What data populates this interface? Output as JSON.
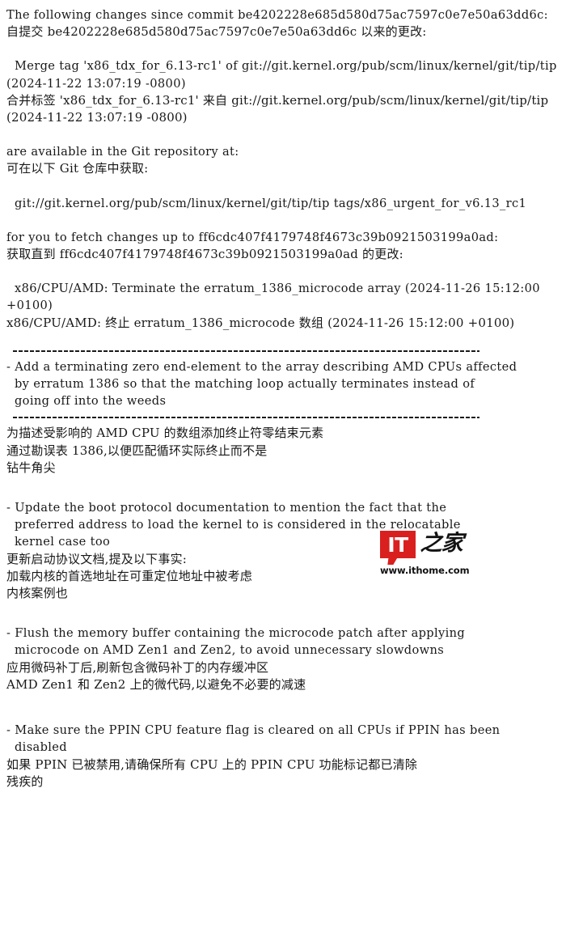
{
  "document": {
    "kind": "kernel-pull-request-bilingual",
    "source_commit": "be4202228e685d580d75ac7597c0e7e50a63dd6c",
    "head_commit": "ff6cdc407f4179748f4673c39b0921503199a0ad",
    "tag": "x86_urgent_for_v6.13_rc1",
    "repo_url": "git://git.kernel.org/pub/scm/linux/kernel/git/tip/tip"
  },
  "body": [
    {
      "id": "intro",
      "lines": [
        {
          "lang": "en",
          "text": "The following changes since commit be4202228e685d580d75ac7597c0e7e50a63dd6c:"
        },
        {
          "lang": "zh",
          "text": "自提交 be4202228e685d580d75ac7597c0e7e50a63dd6c 以来的更改:"
        }
      ]
    },
    {
      "id": "merge-tag",
      "lines": [
        {
          "lang": "en",
          "text": "  Merge tag 'x86_tdx_for_6.13-rc1' of git://git.kernel.org/pub/scm/linux/kernel/git/tip/tip (2024-11-22 13:07:19 -0800)"
        },
        {
          "lang": "zh",
          "text": "合并标签 'x86_tdx_for_6.13-rc1' 来自 git://git.kernel.org/pub/scm/linux/kernel/git/tip/tip (2024-11-22 13:07:19 -0800)"
        }
      ]
    },
    {
      "id": "available-at",
      "lines": [
        {
          "lang": "en",
          "text": "are available in the Git repository at:"
        },
        {
          "lang": "zh",
          "text": "可在以下 Git 仓库中获取:"
        }
      ]
    },
    {
      "id": "repo-url",
      "lines": [
        {
          "lang": "en",
          "text": "  git://git.kernel.org/pub/scm/linux/kernel/git/tip/tip tags/x86_urgent_for_v6.13_rc1"
        }
      ]
    },
    {
      "id": "fetch-up-to",
      "lines": [
        {
          "lang": "en",
          "text": "for you to fetch changes up to ff6cdc407f4179748f4673c39b0921503199a0ad:"
        },
        {
          "lang": "zh",
          "text": "获取直到 ff6cdc407f4179748f4673c39b0921503199a0ad 的更改:"
        }
      ]
    },
    {
      "id": "head-subject",
      "lines": [
        {
          "lang": "en",
          "text": "  x86/CPU/AMD: Terminate the erratum_1386_microcode array (2024-11-26 15:12:00 +0100)"
        },
        {
          "lang": "zh",
          "text": "x86/CPU/AMD: 终止 erratum_1386_microcode 数组 (2024-11-26 15:12:00 +0100)"
        }
      ]
    },
    {
      "id": "item-1",
      "separator_before": true,
      "lines": [
        {
          "lang": "en",
          "text": "- Add a terminating zero end-element to the array describing AMD CPUs affected"
        },
        {
          "lang": "en",
          "text": "  by erratum 1386 so that the matching loop actually terminates instead of"
        },
        {
          "lang": "en",
          "text": "  going off into the weeds"
        }
      ]
    },
    {
      "id": "item-1-zh",
      "separator_before": true,
      "lines": [
        {
          "lang": "zh",
          "text": "为描述受影响的 AMD CPU 的数组添加终止符零结束元素"
        },
        {
          "lang": "zh",
          "text": "通过勘误表 1386,以便匹配循环实际终止而不是"
        },
        {
          "lang": "zh",
          "text": "钻牛角尖"
        }
      ]
    },
    {
      "id": "item-2",
      "lines": [
        {
          "lang": "en",
          "text": "- Update the boot protocol documentation to mention the fact that the"
        },
        {
          "lang": "en",
          "text": "  preferred address to load the kernel to is considered in the relocatable"
        },
        {
          "lang": "en",
          "text": "  kernel case too"
        }
      ]
    },
    {
      "id": "item-2-zh",
      "lines": [
        {
          "lang": "zh",
          "text": "更新启动协议文档,提及以下事实:"
        },
        {
          "lang": "zh",
          "text": "加载内核的首选地址在可重定位地址中被考虑"
        },
        {
          "lang": "zh",
          "text": "内核案例也"
        }
      ]
    },
    {
      "id": "item-3",
      "lines": [
        {
          "lang": "en",
          "text": "- Flush the memory buffer containing the microcode patch after applying"
        },
        {
          "lang": "en",
          "text": "  microcode on AMD Zen1 and Zen2, to avoid unnecessary slowdowns"
        }
      ]
    },
    {
      "id": "item-3-zh",
      "lines": [
        {
          "lang": "zh",
          "text": "应用微码补丁后,刷新包含微码补丁的内存缓冲区"
        },
        {
          "lang": "zh",
          "text": "AMD Zen1 和 Zen2 上的微代码,以避免不必要的减速"
        }
      ]
    },
    {
      "id": "item-4",
      "lines": [
        {
          "lang": "en",
          "text": "- Make sure the PPIN CPU feature flag is cleared on all CPUs if PPIN has been"
        },
        {
          "lang": "en",
          "text": "  disabled"
        }
      ]
    },
    {
      "id": "item-4-zh",
      "lines": [
        {
          "lang": "zh",
          "text": "如果 PPIN 已被禁用,请确保所有 CPU 上的 PPIN CPU 功能标记都已清除"
        },
        {
          "lang": "zh",
          "text": "残疾的"
        }
      ]
    }
  ],
  "watermark": {
    "logo_text": "IT",
    "logo_cn": "之家",
    "url": "www.ithome.com",
    "brand_color": "#d9201f"
  }
}
